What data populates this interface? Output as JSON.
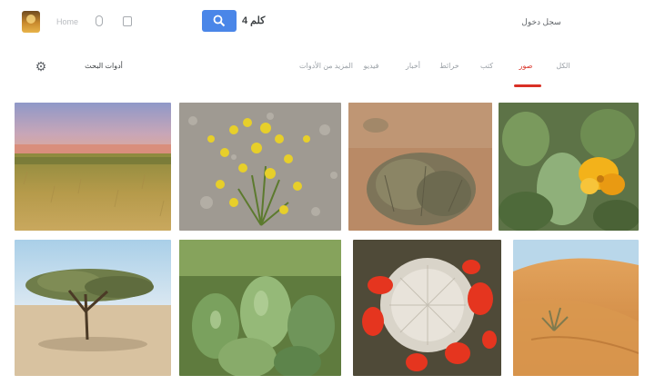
{
  "header": {
    "logo_icon": "app-logo-icon",
    "top_link": "Home",
    "mic_icon": "microphone-icon",
    "camera_icon": "camera-icon",
    "search_button_icon": "search-icon",
    "search_query": "كلم 4",
    "search_placeholder": "",
    "account_link": "سجل دخول"
  },
  "toolbar": {
    "settings_icon": "gear-icon",
    "tools_label": "أدوات البحث"
  },
  "tabs": [
    {
      "label": "المزيد من الأدوات",
      "active": false
    },
    {
      "label": "فيديو",
      "active": false
    },
    {
      "label": "أخبار",
      "active": false
    },
    {
      "label": "خرائط",
      "active": false
    },
    {
      "label": "كتب",
      "active": false
    },
    {
      "label": "صور",
      "active": true
    },
    {
      "label": "الكل",
      "active": false
    }
  ],
  "accent_color": "#d93025",
  "button_color": "#4a86e8",
  "results": [
    {
      "subject": "desert grassland at sunset"
    },
    {
      "subject": "yellow desert wildflowers on gravel"
    },
    {
      "subject": "dry desert shrub on red soil"
    },
    {
      "subject": "prickly pear cactus with yellow flower"
    },
    {
      "subject": "acacia tree in sandy desert"
    },
    {
      "subject": "green prickly pear cactus pads"
    },
    {
      "subject": "white ball cactus with red flowers"
    },
    {
      "subject": "small plant on orange sand dune"
    }
  ]
}
